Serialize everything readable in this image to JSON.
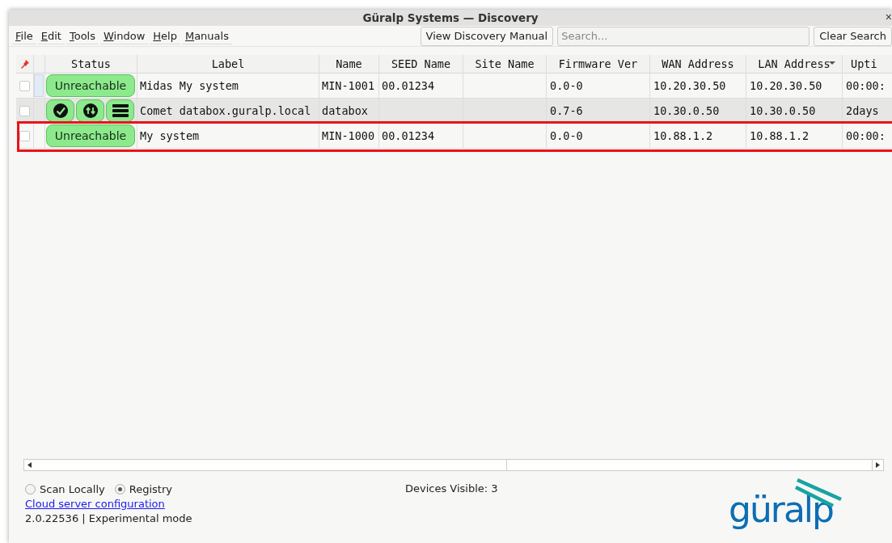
{
  "window": {
    "title": "Güralp Systems — Discovery",
    "close": "×"
  },
  "menu": [
    "File",
    "Edit",
    "Tools",
    "Window",
    "Help",
    "Manuals"
  ],
  "toolbar": {
    "manual_button": "View Discovery Manual",
    "search": {
      "placeholder": "Search..."
    },
    "clear_button": "Clear Search"
  },
  "table": {
    "columns": [
      {
        "label": "Status",
        "sorted": false
      },
      {
        "label": "Label",
        "sorted": false
      },
      {
        "label": "Name",
        "sorted": false
      },
      {
        "label": "SEED Name",
        "sorted": false
      },
      {
        "label": "Site Name",
        "sorted": false
      },
      {
        "label": "Firmware Ver",
        "sorted": false
      },
      {
        "label": "WAN Address",
        "sorted": false
      },
      {
        "label": "LAN Address",
        "sorted": true
      },
      {
        "label": "Upti",
        "sorted": false
      }
    ],
    "rows": [
      {
        "checked": false,
        "selected": false,
        "focused": true,
        "highlighted": false,
        "status": {
          "kind": "badge",
          "text": "Unreachable"
        },
        "label": "Midas My system",
        "name": "MIN-1001",
        "seed_name": "00.01234",
        "firmware": "0.0-0",
        "wan": "10.20.30.50",
        "lan": "10.20.30.50",
        "uptime": "00:00:"
      },
      {
        "checked": false,
        "selected": true,
        "focused": false,
        "highlighted": false,
        "status": {
          "kind": "icons"
        },
        "label": "Comet databox.guralp.local",
        "name": "databox",
        "firmware": "0.7-6",
        "wan": "10.30.0.50",
        "lan": "10.30.0.50",
        "uptime": "2days"
      },
      {
        "checked": false,
        "selected": false,
        "focused": false,
        "highlighted": true,
        "status": {
          "kind": "badge",
          "text": "Unreachable"
        },
        "label": "My system",
        "name": "MIN-1000",
        "seed_name": "00.01234",
        "firmware": "0.0-0",
        "wan": "10.88.1.2",
        "lan": "10.88.1.2",
        "uptime": "00:00:"
      }
    ]
  },
  "footer": {
    "radios": [
      {
        "label": "Scan Locally",
        "selected": false
      },
      {
        "label": "Registry",
        "selected": true
      }
    ],
    "link": "Cloud server configuration",
    "version": "2.0.22536 | Experimental mode",
    "devices": "Devices Visible: 3",
    "logo": "güralp"
  }
}
